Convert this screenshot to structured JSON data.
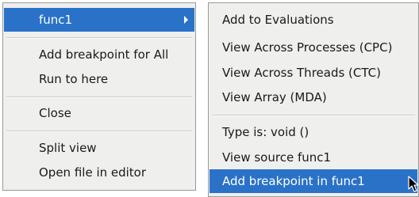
{
  "main_menu": {
    "items": [
      {
        "label": "func1",
        "submenu": true,
        "highlighted": true
      },
      {
        "label": "Add breakpoint for All"
      },
      {
        "label": "Run to here"
      },
      {
        "label": "Close"
      },
      {
        "label": "Split view"
      },
      {
        "label": "Open file in editor"
      }
    ]
  },
  "sub_menu": {
    "items": [
      {
        "label": "Add to Evaluations"
      },
      {
        "label": "View Across Processes (CPC)"
      },
      {
        "label": "View Across Threads (CTC)"
      },
      {
        "label": "View Array (MDA)"
      },
      {
        "label": "Type is: void ()"
      },
      {
        "label": "View source func1"
      },
      {
        "label": "Add breakpoint in func1",
        "highlighted": true
      }
    ]
  },
  "colors": {
    "highlight": "#2a72c8",
    "menu_background": "#efefee"
  },
  "icons": {
    "submenu_arrow": "chevron-right-icon",
    "cursor": "mouse-pointer-icon"
  }
}
